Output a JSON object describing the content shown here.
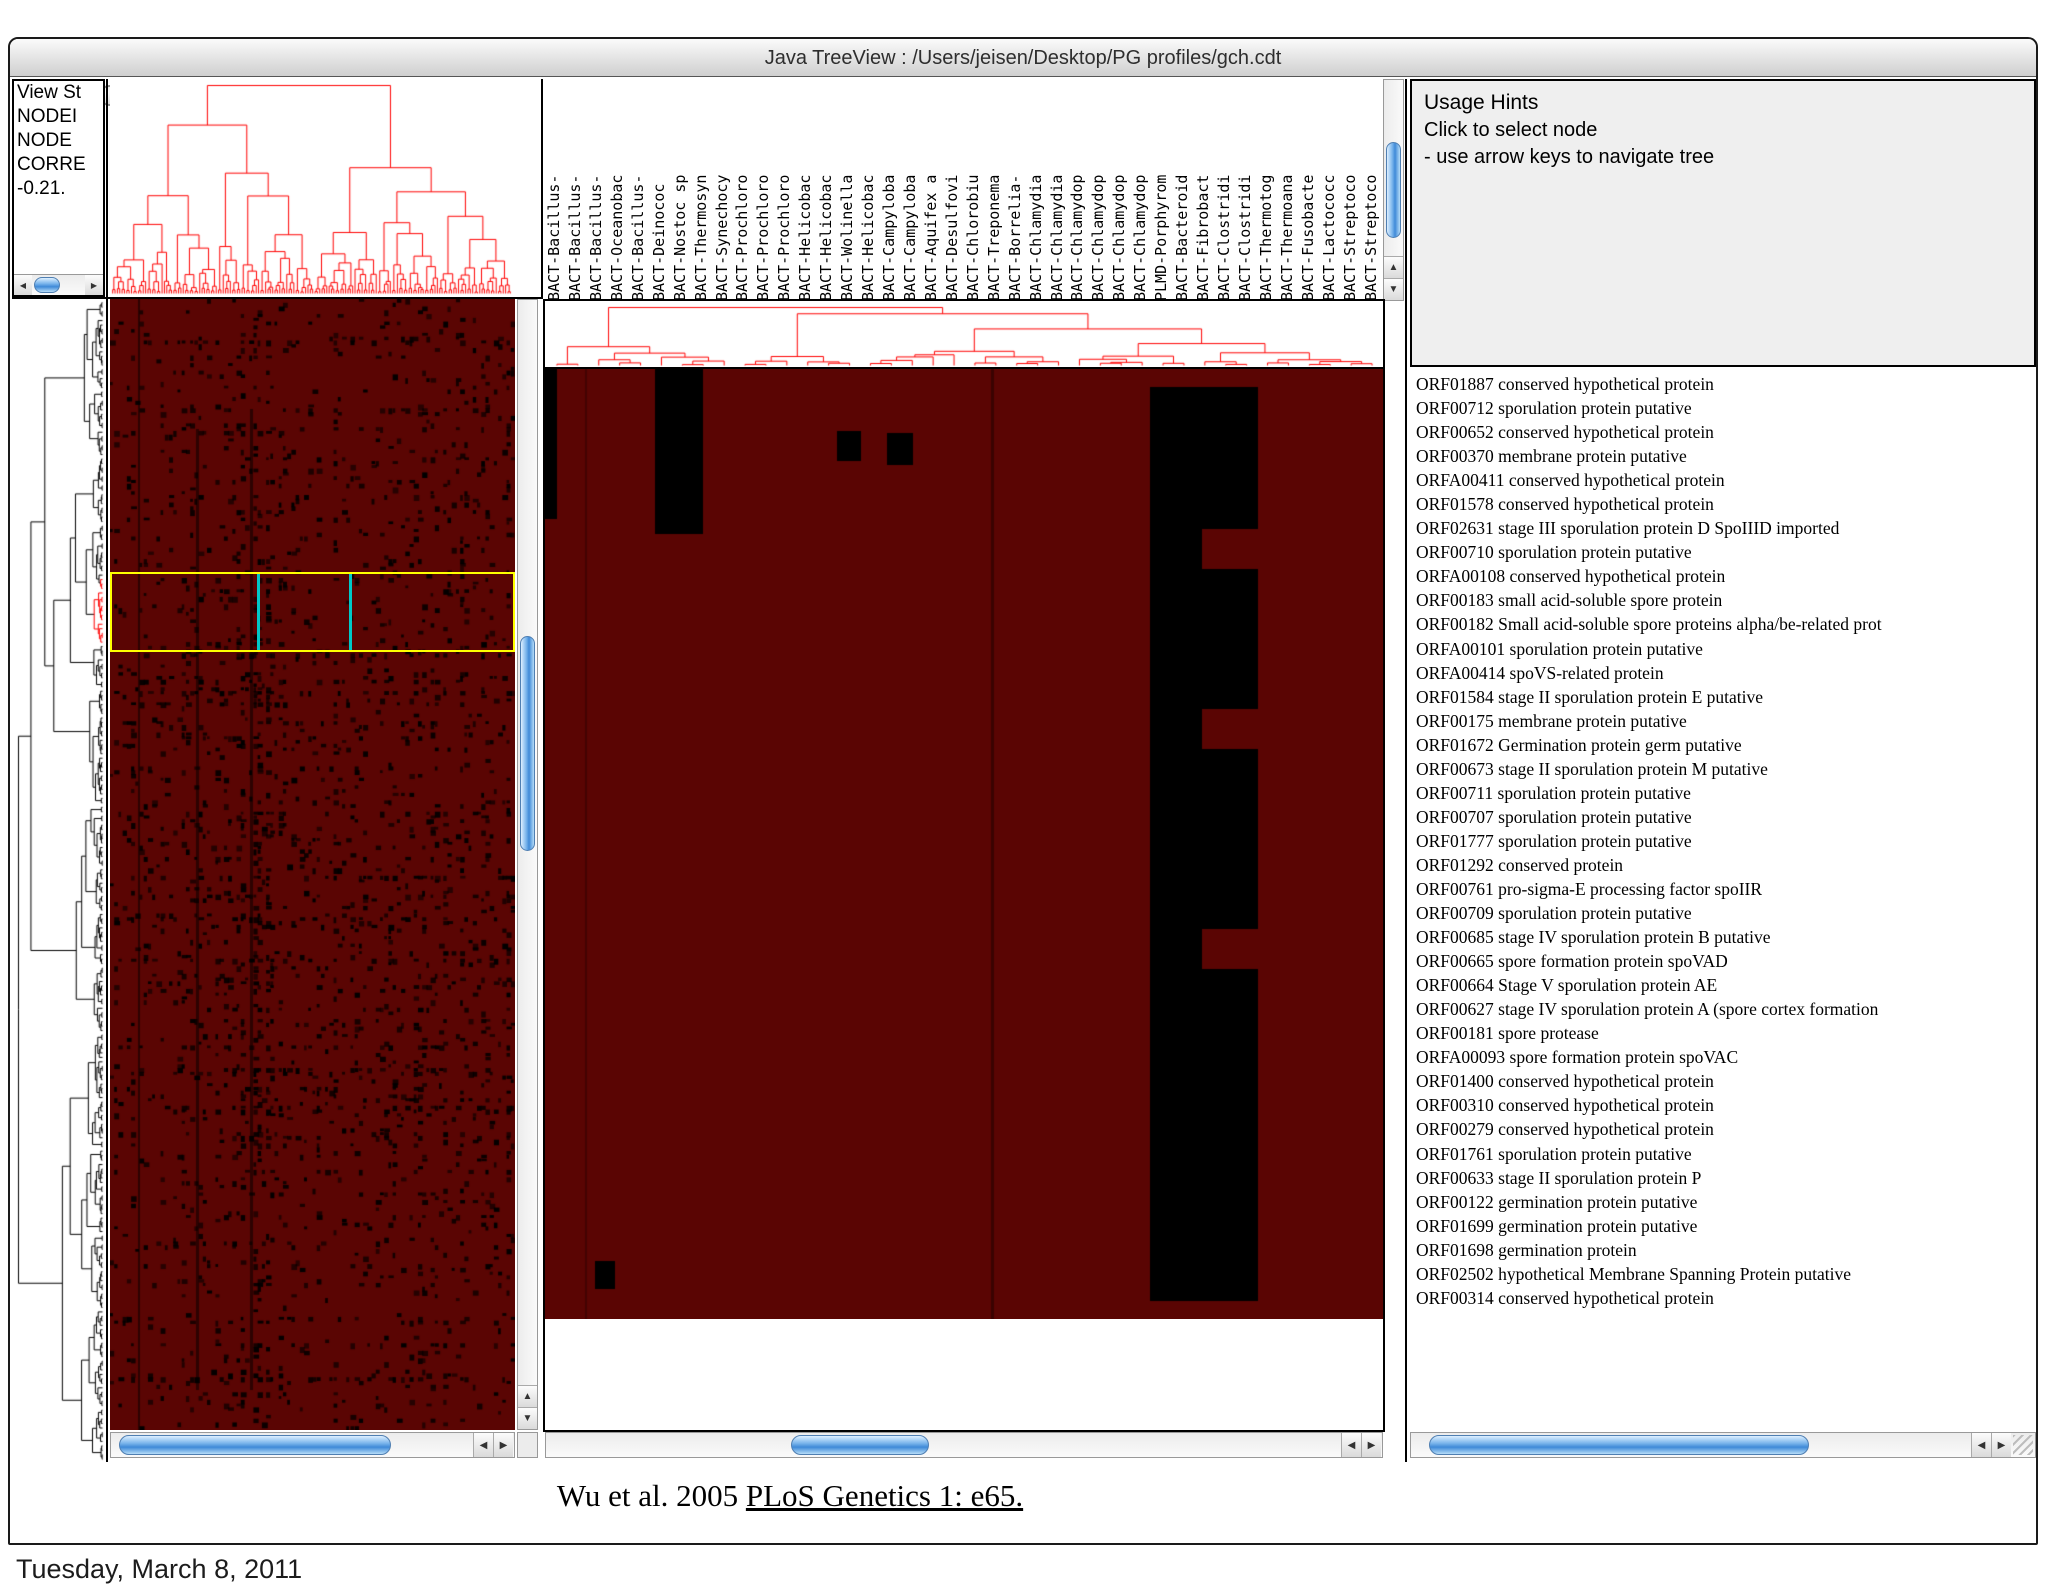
{
  "window": {
    "title": "Java TreeView : /Users/jeisen/Desktop/PG profiles/gch.cdt"
  },
  "icons": {
    "left": "◀",
    "right": "▶",
    "up": "▲",
    "down": "▼"
  },
  "status_panel": {
    "lines": [
      "View St",
      "NODEI",
      "NODE",
      "CORRE",
      "-0.21."
    ]
  },
  "usage_hints": {
    "title": "Usage Hints",
    "line1": "Click to select node",
    "line2": "- use arrow keys to navigate tree"
  },
  "column_labels": [
    "BACT-Bacillus-",
    "BACT-Bacillus-",
    "BACT-Bacillus-",
    "BACT-Oceanobac",
    "BACT-Bacillus-",
    "BACT-Deinococ",
    "BACT-Nostoc sp",
    "BACT-Thermosyn",
    "BACT-Synechocy",
    "BACT-Prochloro",
    "BACT-Prochloro",
    "BACT-Prochloro",
    "BACT-Helicobac",
    "BACT-Helicobac",
    "BACT-Wolinella",
    "BACT-Helicobac",
    "BACT-Campyloba",
    "BACT-Campyloba",
    "BACT-Aquifex a",
    "BACT-Desulfovi",
    "BACT-Chlorobiu",
    "BACT-Treponema",
    "BACT-Borrelia-",
    "BACT-Chlamydia",
    "BACT-Chlamydia",
    "BACT-Chlamydop",
    "BACT-Chlamydop",
    "BACT-Chlamydop",
    "BACT-Chlamydop",
    "PLMD-Porphyrom",
    "BACT-Bacteroid",
    "BACT-Fibrobact",
    "BACT-Clostridi",
    "BACT-Clostridi",
    "BACT-Thermotog",
    "BACT-Thermoana",
    "BACT-Fusobacte",
    "BACT-Lactococc",
    "BACT-Streptoco",
    "BACT-Streptoco"
  ],
  "gene_labels": [
    "ORF01887 conserved hypothetical protein",
    "ORF00712 sporulation protein putative",
    "ORF00652 conserved hypothetical protein",
    "ORF00370 membrane protein putative",
    "ORFA00411 conserved hypothetical protein",
    "ORF01578 conserved hypothetical protein",
    "ORF02631 stage III sporulation protein D SpoIIID imported",
    "ORF00710 sporulation protein putative",
    "ORFA00108 conserved hypothetical protein",
    "ORF00183 small acid-soluble spore protein",
    "ORF00182 Small acid-soluble spore proteins alpha/be-related prot",
    "ORFA00101 sporulation protein putative",
    "ORFA00414 spoVS-related protein",
    "ORF01584 stage II sporulation protein E putative",
    "ORF00175 membrane protein putative",
    "ORF01672 Germination protein germ putative",
    "ORF00673 stage II sporulation protein M putative",
    "ORF00711 sporulation protein putative",
    "ORF00707 sporulation protein putative",
    "ORF01777 sporulation protein putative",
    "ORF01292 conserved protein",
    "ORF00761 pro-sigma-E processing factor spoIIR",
    "ORF00709 sporulation protein putative",
    "ORF00685 stage IV sporulation protein B putative",
    "ORF00665 spore formation protein spoVAD",
    "ORF00664 Stage V sporulation protein AE",
    "ORF00627 stage IV sporulation protein A (spore cortex formation",
    "ORF00181 spore protease",
    "ORFA00093 spore formation protein spoVAC",
    "ORF01400 conserved hypothetical protein",
    "ORF00310 conserved hypothetical protein",
    "ORF00279 conserved hypothetical protein",
    "ORF01761 sporulation protein putative",
    "ORF00633 stage II sporulation protein P",
    "ORF00122 germination protein putative",
    "ORF01699 germination protein putative",
    "ORF01698 germination protein",
    "ORF02502 hypothetical Membrane Spanning Protein putative",
    "ORF00314 conserved hypothetical protein"
  ],
  "caption": {
    "prefix": "Wu et al. 2005 ",
    "link": "PLoS Genetics 1: e65."
  },
  "footer": {
    "date": "Tuesday, March 8, 2011"
  },
  "colors": {
    "heatmap": "#5a0503",
    "tree_red": "#ff0000",
    "tree_black": "#000000",
    "selection_box": "#ffff00",
    "selection_lines": "#00c8c8"
  }
}
